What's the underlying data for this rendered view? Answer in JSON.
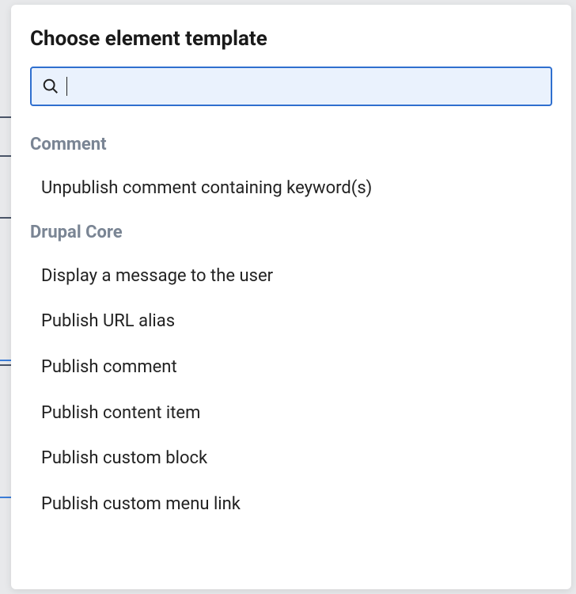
{
  "dialog": {
    "title": "Choose element template"
  },
  "search": {
    "value": "",
    "placeholder": ""
  },
  "groups": [
    {
      "label": "Comment",
      "items": [
        "Unpublish comment containing keyword(s)"
      ]
    },
    {
      "label": "Drupal Core",
      "items": [
        "Display a message to the user",
        "Publish URL alias",
        "Publish comment",
        "Publish content item",
        "Publish custom block",
        "Publish custom menu link"
      ]
    }
  ]
}
